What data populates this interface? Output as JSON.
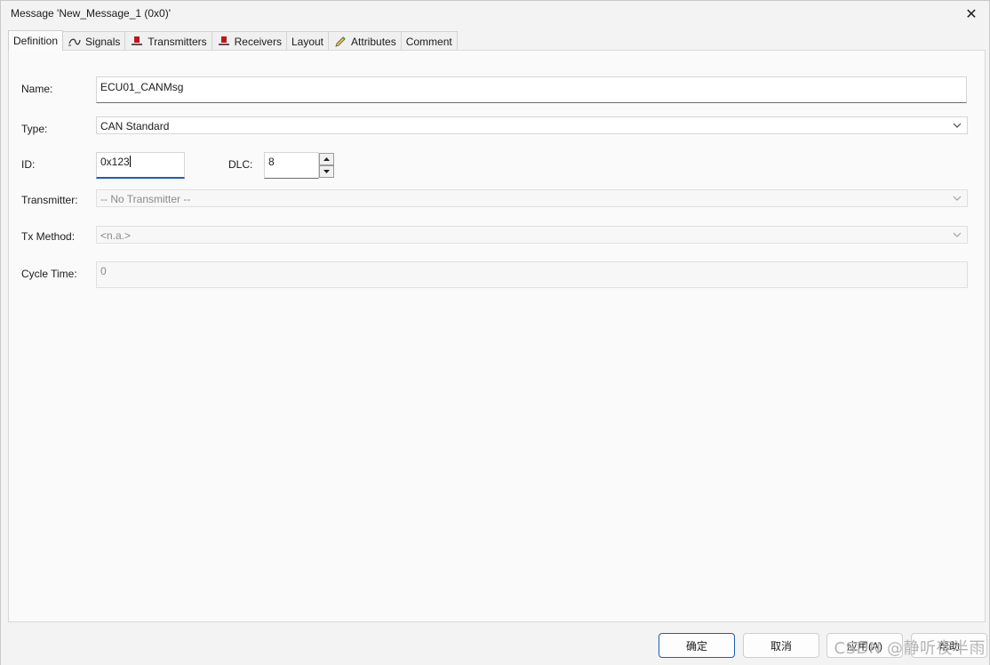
{
  "window": {
    "title": "Message 'New_Message_1 (0x0)'",
    "close_glyph": "✕"
  },
  "tabs": [
    {
      "label": "Definition",
      "icon": "",
      "active": true
    },
    {
      "label": "Signals",
      "icon": "signals-icon"
    },
    {
      "label": "Transmitters",
      "icon": "transmitter-icon"
    },
    {
      "label": "Receivers",
      "icon": "receiver-icon"
    },
    {
      "label": "Layout",
      "icon": ""
    },
    {
      "label": "Attributes",
      "icon": "pencil-icon"
    },
    {
      "label": "Comment",
      "icon": ""
    }
  ],
  "form": {
    "name_label": "Name:",
    "name_value": "ECU01_CANMsg",
    "type_label": "Type:",
    "type_value": "CAN Standard",
    "id_label": "ID:",
    "id_value": "0x123",
    "dlc_label": "DLC:",
    "dlc_value": "8",
    "transmitter_label": "Transmitter:",
    "transmitter_value": "-- No Transmitter --",
    "txmethod_label": "Tx Method:",
    "txmethod_value": "<n.a.>",
    "cycletime_label": "Cycle Time:",
    "cycletime_value": "0"
  },
  "buttons": {
    "ok": "确定",
    "cancel": "取消",
    "apply": "应用(A)",
    "help": "帮助"
  },
  "watermark": "CSDN @静听夜半雨",
  "colors": {
    "accent": "#1a5fb4",
    "tab_icon_red": "#c0161b"
  }
}
